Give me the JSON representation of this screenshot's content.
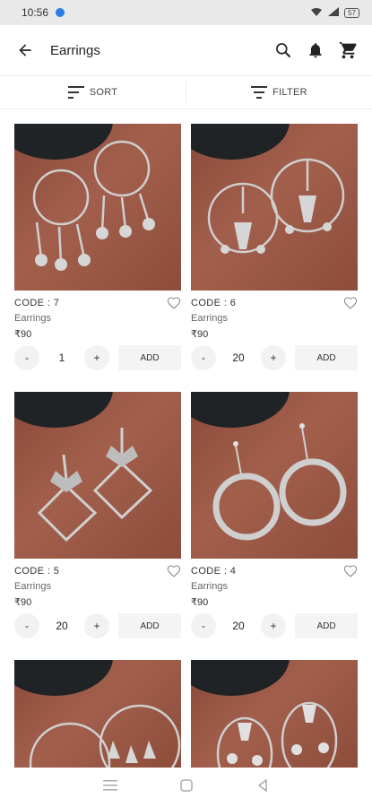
{
  "status_bar": {
    "time": "10:56",
    "battery": "57"
  },
  "app_bar": {
    "title": "Earrings",
    "icons": [
      "back-arrow-icon",
      "search-icon",
      "bell-icon",
      "cart-icon"
    ]
  },
  "toolbar": {
    "sort_label": "SORT",
    "filter_label": "FILTER"
  },
  "products": [
    {
      "code": "CODE : 7",
      "category": "Earrings",
      "price": "₹90",
      "qty": "1",
      "add_label": "ADD",
      "minus": "-",
      "plus": "+"
    },
    {
      "code": "CODE : 6",
      "category": "Earrings",
      "price": "₹90",
      "qty": "20",
      "add_label": "ADD",
      "minus": "-",
      "plus": "+"
    },
    {
      "code": "CODE : 5",
      "category": "Earrings",
      "price": "₹90",
      "qty": "20",
      "add_label": "ADD",
      "minus": "-",
      "plus": "+"
    },
    {
      "code": "CODE : 4",
      "category": "Earrings",
      "price": "₹90",
      "qty": "20",
      "add_label": "ADD",
      "minus": "-",
      "plus": "+"
    }
  ],
  "colors": {
    "accent": "#2d7be5",
    "card_bg": "#9c5a47",
    "button_bg": "#f2f2f2"
  }
}
